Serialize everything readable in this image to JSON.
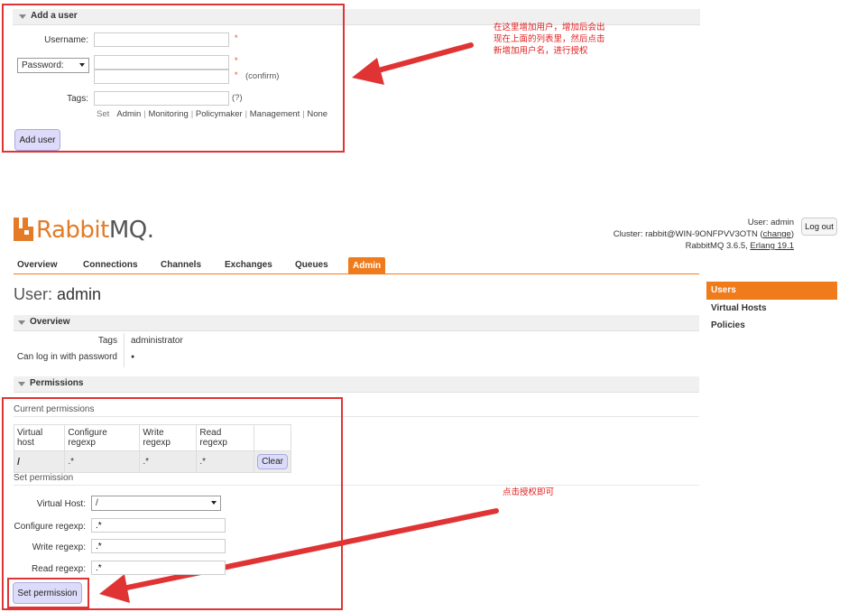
{
  "add_user": {
    "section_title": "Add a user",
    "username_label": "Username:",
    "password_select": "Password:",
    "confirm_note": "(confirm)",
    "tags_label": "Tags:",
    "tags_help": "(?)",
    "tags_set_label": "Set",
    "tag_options": [
      "Admin",
      "Monitoring",
      "Policymaker",
      "Management",
      "None"
    ],
    "required_mark": "*",
    "button_label": "Add user"
  },
  "annotations": {
    "top": [
      "在这里增加用户，增加后会出",
      "现在上面的列表里，然后点击",
      "新增加用户名，进行授权"
    ],
    "bottom": "点击授权即可"
  },
  "header": {
    "logo_rabbit": "Rabbit",
    "logo_mq": "MQ.",
    "user_line_label": "User:",
    "user_name": "admin",
    "cluster_label": "Cluster:",
    "cluster_name": "rabbit@WIN-9ONFPVV3OTN",
    "change_link": "change",
    "version_line": "RabbitMQ 3.6.5,",
    "erlang_version": "Erlang 19.1",
    "logout_label": "Log out"
  },
  "nav": {
    "tabs": [
      "Overview",
      "Connections",
      "Channels",
      "Exchanges",
      "Queues",
      "Admin"
    ],
    "active": "Admin"
  },
  "sidebar": {
    "items": [
      "Users",
      "Virtual Hosts",
      "Policies"
    ],
    "active": "Users"
  },
  "page": {
    "title_prefix": "User:",
    "title_name": "admin",
    "overview_title": "Overview",
    "tags_label": "Tags",
    "tags_value": "administrator",
    "login_label": "Can log in with password",
    "login_value": "●",
    "permissions_title": "Permissions",
    "current_permissions_title": "Current permissions",
    "table": {
      "headers": [
        "Virtual host",
        "Configure regexp",
        "Write regexp",
        "Read regexp"
      ],
      "rows": [
        {
          "vhost": "/",
          "configure": ".*",
          "write": ".*",
          "read": ".*",
          "action": "Clear"
        }
      ]
    },
    "set_permission_title": "Set permission",
    "vhost_label": "Virtual Host:",
    "vhost_value": "/",
    "configure_label": "Configure regexp:",
    "configure_value": ".*",
    "write_label": "Write regexp:",
    "write_value": ".*",
    "read_label": "Read regexp:",
    "read_value": ".*",
    "set_button_label": "Set permission"
  },
  "colors": {
    "accent_orange": "#f07b1b",
    "annotation_red": "#e03434",
    "button_lilac": "#dcdcfa"
  }
}
